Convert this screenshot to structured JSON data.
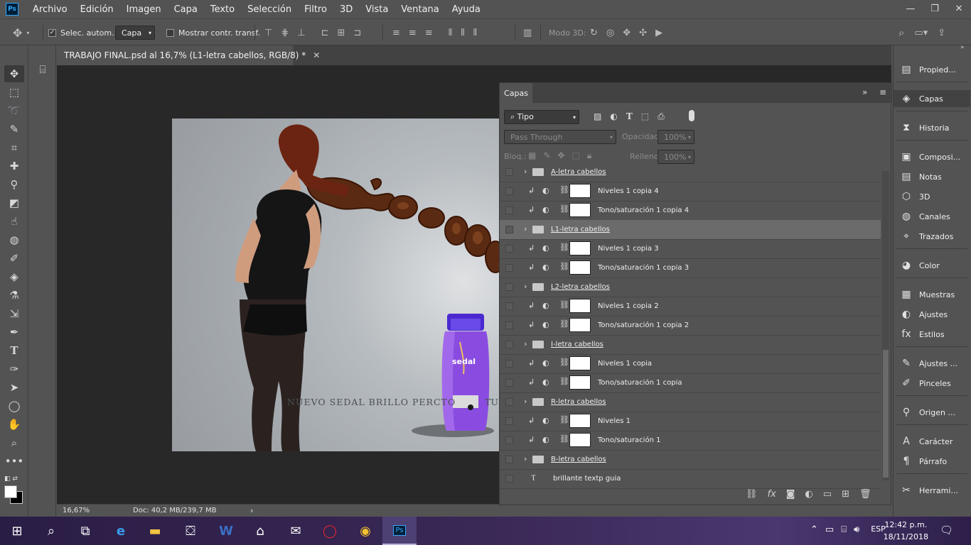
{
  "app": {
    "logo": "Ps"
  },
  "menu": [
    "Archivo",
    "Edición",
    "Imagen",
    "Capa",
    "Texto",
    "Selección",
    "Filtro",
    "3D",
    "Vista",
    "Ventana",
    "Ayuda"
  ],
  "window_controls": {
    "minimize": "—",
    "restore": "❐",
    "close": "✕"
  },
  "options_bar": {
    "auto_select_label": "Selec. autom.:",
    "auto_select_target": "Capa",
    "show_transform_label": "Mostrar contr. transf.",
    "mode_3d_label": "Modo 3D:"
  },
  "document": {
    "tab_title": "TRABAJO FINAL.psd al 16,7% (L1-letra cabellos, RGB/8) *",
    "artwork_text": "NUEVO SEDAL BRILLO PERCTO",
    "artwork_text_right": "TU",
    "bottle_brand": "sedal"
  },
  "status": {
    "zoom": "16,67%",
    "doc_info": "Doc: 40,2 MB/239,7 MB",
    "arrow": "›"
  },
  "layers_panel": {
    "title": "Capas",
    "filter_kind": "Tipo",
    "blend_mode": "Pass Through",
    "opacity_label": "Opacidad:",
    "opacity_value": "100%",
    "lock_label": "Bloq.:",
    "fill_label": "Relleno:",
    "fill_value": "100%",
    "layers": [
      {
        "name": "A-letra cabellos",
        "type": "group"
      },
      {
        "name": "Niveles 1 copia 4",
        "type": "adjust"
      },
      {
        "name": "Tono/saturación 1 copia 4",
        "type": "adjust"
      },
      {
        "name": "L1-letra cabellos",
        "type": "group",
        "selected": true
      },
      {
        "name": "Niveles 1 copia 3",
        "type": "adjust"
      },
      {
        "name": "Tono/saturación 1 copia 3",
        "type": "adjust"
      },
      {
        "name": "L2-letra cabellos",
        "type": "group"
      },
      {
        "name": "Niveles 1 copia 2",
        "type": "adjust"
      },
      {
        "name": "Tono/saturación 1 copia 2",
        "type": "adjust"
      },
      {
        "name": "I-letra cabellos",
        "type": "group"
      },
      {
        "name": "Niveles 1 copia",
        "type": "adjust"
      },
      {
        "name": "Tono/saturación 1 copia",
        "type": "adjust"
      },
      {
        "name": "R-letra cabellos",
        "type": "group"
      },
      {
        "name": "Niveles 1",
        "type": "adjust"
      },
      {
        "name": "Tono/saturación 1",
        "type": "adjust"
      },
      {
        "name": "B-letra cabellos",
        "type": "group"
      },
      {
        "name": "brillante textp guia",
        "type": "text"
      }
    ]
  },
  "dock": [
    {
      "label": "Propied...",
      "icon": "properties-icon"
    },
    {
      "label": "Capas",
      "icon": "layers-icon",
      "active": true
    },
    {
      "label": "Historia",
      "icon": "history-icon"
    },
    {
      "label": "Composi...",
      "icon": "comps-icon"
    },
    {
      "label": "Notas",
      "icon": "notes-icon"
    },
    {
      "label": "3D",
      "icon": "cube-icon"
    },
    {
      "label": "Canales",
      "icon": "channels-icon"
    },
    {
      "label": "Trazados",
      "icon": "paths-icon"
    },
    {
      "label": "Color",
      "icon": "palette-icon"
    },
    {
      "label": "Muestras",
      "icon": "swatches-icon"
    },
    {
      "label": "Ajustes",
      "icon": "adjustments-icon"
    },
    {
      "label": "Estilos",
      "icon": "styles-icon"
    },
    {
      "label": "Ajustes ...",
      "icon": "brush-settings-icon"
    },
    {
      "label": "Pinceles",
      "icon": "brushes-icon"
    },
    {
      "label": "Origen ...",
      "icon": "clone-source-icon"
    },
    {
      "label": "Carácter",
      "icon": "character-icon"
    },
    {
      "label": "Párrafo",
      "icon": "paragraph-icon"
    },
    {
      "label": "Herrami...",
      "icon": "tool-presets-icon"
    }
  ],
  "taskbar": {
    "language": "ESP",
    "time": "12:42 p.m.",
    "date": "18/11/2018"
  }
}
